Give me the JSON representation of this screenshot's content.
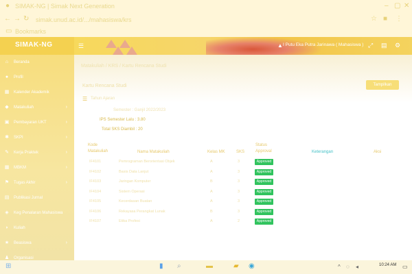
{
  "browser": {
    "tab_title": "SIMAK-NG | Simak Next Generation",
    "address": "simak.unud.ac.id/.../mahasiswa/krs",
    "bookmark": "Bookmarks"
  },
  "brand": {
    "title": "SIMAK-NG"
  },
  "topbar": {
    "user": "I Putu Eka Putra Jarinawa ( Mahasiswa )"
  },
  "nav": [
    {
      "label": "Beranda",
      "icon": "home-icon",
      "chev": ""
    },
    {
      "label": "Profil",
      "icon": "user-icon",
      "chev": ""
    },
    {
      "label": "Kalender Akademik",
      "icon": "calendar-icon",
      "chev": ""
    },
    {
      "label": "Matakuliah",
      "icon": "book-icon",
      "chev": "›"
    },
    {
      "label": "Pembayaran UKT",
      "icon": "wallet-icon",
      "chev": "›"
    },
    {
      "label": "SKPI",
      "icon": "asterisk-icon",
      "chev": "›"
    },
    {
      "label": "Kerja Praktek",
      "icon": "wrench-icon",
      "chev": "›"
    },
    {
      "label": "MBKM",
      "icon": "grid-icon",
      "chev": "›"
    },
    {
      "label": "Tugas Akhir",
      "icon": "flag-icon",
      "chev": "›"
    },
    {
      "label": "Publikasi Jurnal",
      "icon": "doc-icon",
      "chev": ""
    },
    {
      "label": "Keg Penalaran Mahasiswa",
      "icon": "bulb-icon",
      "chev": ""
    },
    {
      "label": "Kuliah",
      "icon": "tag-icon",
      "chev": ""
    },
    {
      "label": "Beasiswa",
      "icon": "star-icon",
      "chev": "›"
    },
    {
      "label": "Organisasi",
      "icon": "people-icon",
      "chev": ""
    }
  ],
  "main": {
    "breadcrumb": "Matakuliah / KRS / Kartu Rencana Studi",
    "search_title": "Kartu Rencana Studi",
    "filter_button": "Tampilkan",
    "section_label": "Tahun Ajaran",
    "info_lines": [
      "Semester : Ganjil 2022/2023",
      "IPS Semester Lalu : 3.80",
      "Total SKS Diambil : 20"
    ],
    "table": {
      "headers": [
        "Kode Matakuliah",
        "Nama Matakuliah",
        "Kelas MK",
        "SKS",
        "Status Approval",
        "Keterangan",
        "Aksi"
      ],
      "rows": [
        {
          "kode": "IF4101",
          "nama": "Pemrograman Berorientasi Objek",
          "kelas": "A",
          "sks": "3",
          "status": "Approved"
        },
        {
          "kode": "IF4102",
          "nama": "Basis Data Lanjut",
          "kelas": "A",
          "sks": "3",
          "status": "Approved"
        },
        {
          "kode": "IF4103",
          "nama": "Jaringan Komputer",
          "kelas": "B",
          "sks": "3",
          "status": "Approved"
        },
        {
          "kode": "IF4104",
          "nama": "Sistem Operasi",
          "kelas": "A",
          "sks": "3",
          "status": "Approved"
        },
        {
          "kode": "IF4105",
          "nama": "Kecerdasan Buatan",
          "kelas": "A",
          "sks": "3",
          "status": "Approved"
        },
        {
          "kode": "IF4106",
          "nama": "Rekayasa Perangkat Lunak",
          "kelas": "B",
          "sks": "3",
          "status": "Approved"
        },
        {
          "kode": "IF4107",
          "nama": "Etika Profesi",
          "kelas": "A",
          "sks": "2",
          "status": "Approved"
        }
      ]
    }
  },
  "taskbar": {
    "time": "10:24 AM"
  },
  "colors": {
    "accent": "#f4d150",
    "badge": "#31c35e",
    "keterangan": "#43c0c6"
  }
}
